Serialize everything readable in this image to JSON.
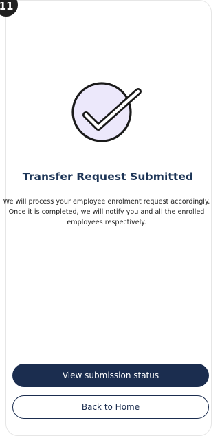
{
  "step_number": "11",
  "colors": {
    "primary": "#1b2d4f",
    "title": "#1d3557",
    "success_circle_fill": "#ece8fb"
  },
  "success": {
    "icon": "checkmark-circle-icon",
    "title": "Transfer Request Submitted",
    "description": "We will process your employee enrolment request accordingly. Once it is completed, we will notify you and all the enrolled employees respectively."
  },
  "actions": {
    "view_status_label": "View submission status",
    "home_label": "Back to Home"
  }
}
